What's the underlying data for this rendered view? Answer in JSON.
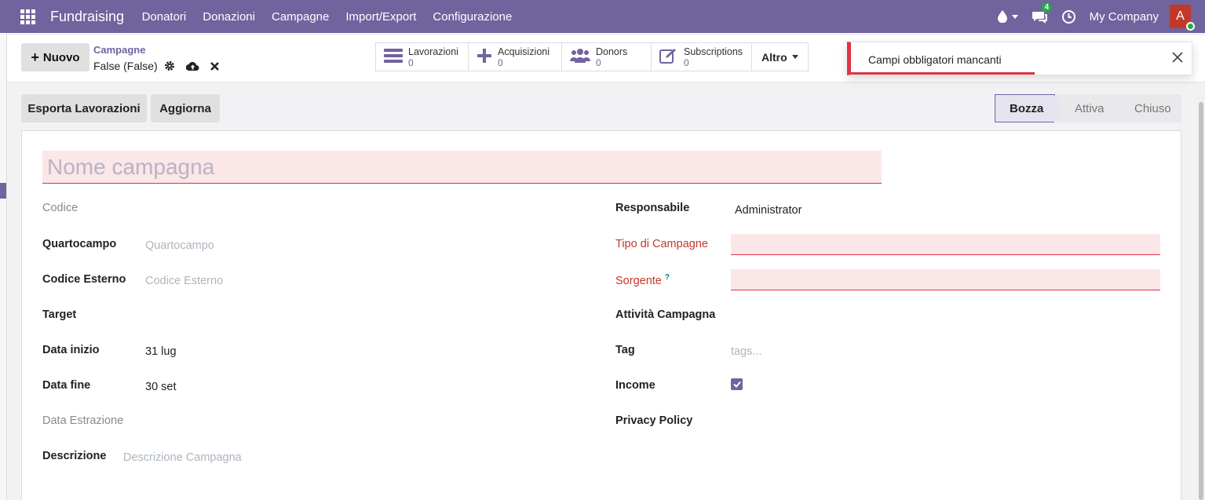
{
  "navbar": {
    "brand": "Fundraising",
    "menu": [
      "Donatori",
      "Donazioni",
      "Campagne",
      "Import/Export",
      "Configurazione"
    ],
    "chat_badge": "4",
    "company": "My Company",
    "avatar_letter": "A"
  },
  "control": {
    "new_label": "Nuovo",
    "breadcrumb": "Campagne",
    "record": "False (False)",
    "smart_buttons": [
      {
        "label": "Lavorazioni",
        "count": "0",
        "icon": "list-icon"
      },
      {
        "label": "Acquisizioni",
        "count": "0",
        "icon": "plus-icon"
      },
      {
        "label": "Donors",
        "count": "0",
        "icon": "users-icon"
      },
      {
        "label": "Subscriptions",
        "count": "0",
        "icon": "edit-icon"
      }
    ],
    "more_label": "Altro"
  },
  "toast": {
    "message": "Campi obbligatori mancanti",
    "progress": 0.54
  },
  "actions": {
    "export_label": "Esporta Lavorazioni",
    "refresh_label": "Aggiorna"
  },
  "status": {
    "stages": [
      "Bozza",
      "Attiva",
      "Chiuso"
    ],
    "current": "Bozza"
  },
  "form": {
    "name_placeholder": "Nome campagna",
    "left": {
      "codice": "Codice",
      "quartocampo": "Quartocampo",
      "quartocampo_ph": "Quartocampo",
      "codice_esterno": "Codice Esterno",
      "codice_esterno_ph": "Codice Esterno",
      "target": "Target",
      "data_inizio": "Data inizio",
      "data_inizio_val": "31 lug",
      "data_fine": "Data fine",
      "data_fine_val": "30 set",
      "data_estrazione": "Data Estrazione",
      "descrizione": "Descrizione",
      "descrizione_ph": "Descrizione Campagna"
    },
    "right": {
      "responsabile": "Responsabile",
      "responsabile_val": "Administrator",
      "tipo": "Tipo di Campagne",
      "sorgente": "Sorgente",
      "sorgente_help": "?",
      "attivita": "Attività Campagna",
      "tag": "Tag",
      "tag_ph": "tags...",
      "income": "Income",
      "income_checked": true,
      "privacy": "Privacy Policy"
    }
  },
  "colors": {
    "brand": "#71639e",
    "danger": "#dc3545",
    "required_bg": "#fbe6e8"
  }
}
